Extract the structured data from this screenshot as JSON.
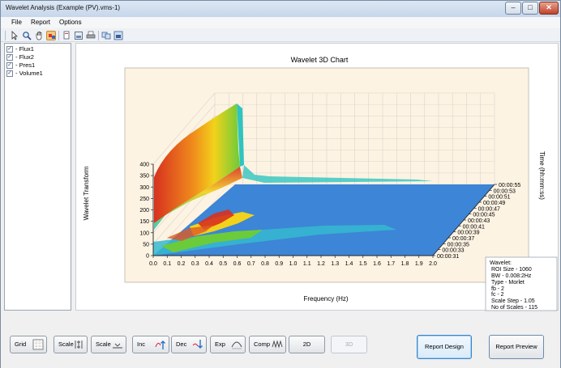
{
  "window": {
    "title": "Wavelet Analysis (Example (PV).vms-1)"
  },
  "title_controls": {
    "minimize": "–",
    "maximize": "□",
    "close": "✕"
  },
  "menu": {
    "file": "File",
    "report": "Report",
    "options": "Options"
  },
  "toolbar": {
    "icons": [
      "pointer-icon",
      "zoom-icon",
      "pan-icon",
      "color-palette-icon",
      "copy-icon",
      "save-image-icon",
      "print-icon",
      "copy-data-icon",
      "export-icon"
    ]
  },
  "sidebar": {
    "items": [
      {
        "label": "Flux1",
        "checked": true
      },
      {
        "label": "Flux2",
        "checked": true
      },
      {
        "label": "Pres1",
        "checked": true
      },
      {
        "label": "Volume1",
        "checked": true
      }
    ]
  },
  "chart": {
    "title": "Wavelet 3D Chart",
    "xlabel": "Frequency (Hz)",
    "ylabel": "Wavelet Transform",
    "zlabel": "Time (hh:mm:ss)"
  },
  "chart_data": {
    "type": "surface",
    "title": "Wavelet 3D Chart",
    "xlabel": "Frequency (Hz)",
    "ylabel": "Wavelet Transform",
    "zlabel": "Time (hh:mm:ss)",
    "x_ticks": [
      "0.0",
      "0.1",
      "0.2",
      "0.3",
      "0.4",
      "0.5",
      "0.6",
      "0.7",
      "0.8",
      "0.9",
      "1.0",
      "1.1",
      "1.2",
      "1.3",
      "1.4",
      "1.5",
      "1.6",
      "1.7",
      "1.8",
      "1.9",
      "2.0"
    ],
    "y_ticks": [
      "0",
      "50",
      "100",
      "150",
      "200",
      "250",
      "300",
      "350",
      "400"
    ],
    "z_ticks": [
      "00:00:31",
      "00:00:33",
      "00:00:35",
      "00:00:37",
      "00:00:39",
      "00:00:41",
      "00:00:43",
      "00:00:45",
      "00:00:47",
      "00:00:49",
      "00:00:51",
      "00:00:53",
      "00:00:55"
    ],
    "ylim": [
      0,
      400
    ],
    "xlim": [
      0,
      2.0
    ],
    "grid": true,
    "colors": {
      "background": "#fdf3e3",
      "base": "#3d85d6",
      "ridge_high": "#d7311f",
      "ridge_mid": "#f2d21a",
      "ridge_low": "#6ccb3a",
      "ridge_cyan": "#33c4c6"
    }
  },
  "info_box": {
    "lines": [
      "Wavelet:",
      "ROI Size - 1060",
      "BW - 0.008:2Hz",
      "Type - Morlet",
      "fb - 2",
      "fc - 2",
      "Scale Step - 1.05",
      "No of Scales - 115"
    ]
  },
  "buttons": {
    "grid": "Grid",
    "scale_y": "Scale",
    "scale_x": "Scale",
    "inc": "Inc",
    "dec": "Dec",
    "exp": "Exp",
    "comp": "Comp",
    "two_d": "2D",
    "three_d": "3D",
    "report_design": "Report Design",
    "report_preview": "Report Preview"
  }
}
